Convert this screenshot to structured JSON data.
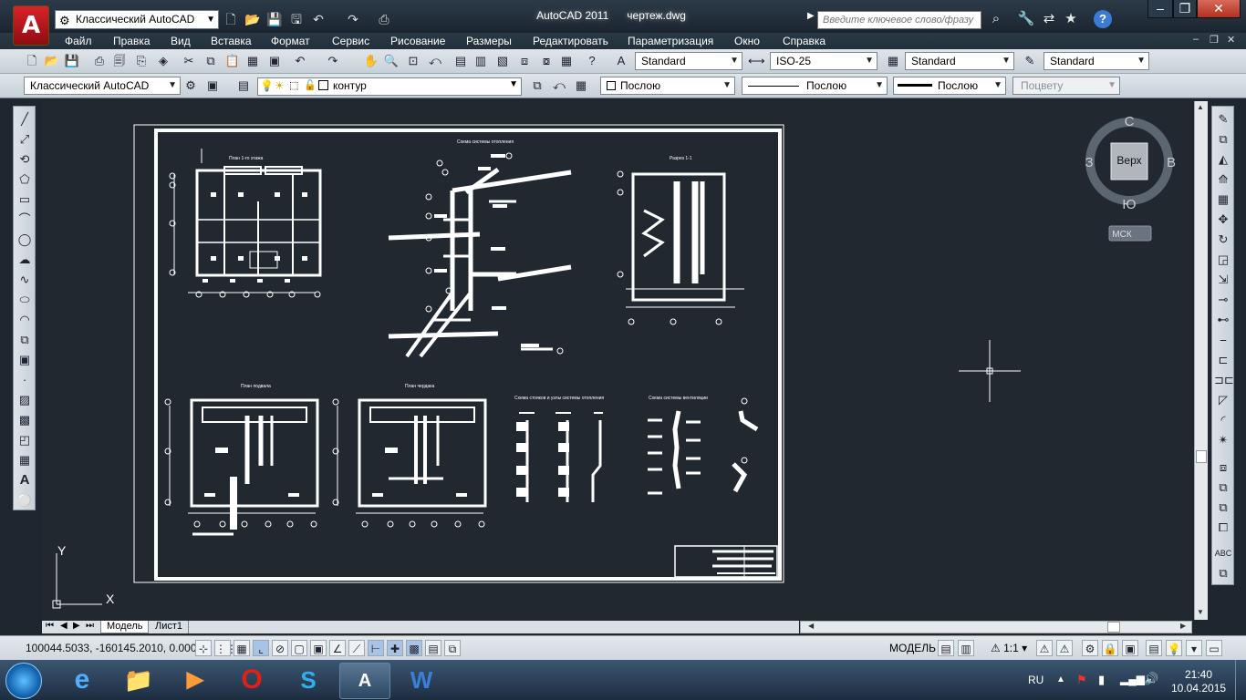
{
  "titlebar": {
    "workspace": "Классический AutoCAD",
    "app_name": "AutoCAD 2011",
    "doc_name": "чертеж.dwg",
    "search_placeholder": "Введите ключевое слово/фразу",
    "help": "?"
  },
  "menu": [
    "Файл",
    "Правка",
    "Вид",
    "Вставка",
    "Формат",
    "Сервис",
    "Рисование",
    "Размеры",
    "Редактировать",
    "Параметризация",
    "Окно",
    "Справка"
  ],
  "styles": {
    "text_style": "Standard",
    "dim_style": "ISO-25",
    "table_style": "Standard",
    "mleader_style": "Standard"
  },
  "layers": {
    "workspace": "Классический AutoCAD",
    "current_layer": "контур",
    "color": "Послою",
    "linetype": "Послою",
    "lineweight": "Послою",
    "plotstyle": "Поцвету"
  },
  "viewcube": {
    "north": "С",
    "south": "Ю",
    "east": "В",
    "west": "З",
    "face": "Верх",
    "ucs": "МСК"
  },
  "drawing": {
    "title_center": "Схема системы отопления",
    "title_right": "Разрез 1-1",
    "title_left": "План 1-го этажа",
    "title_bl1": "План подвала",
    "title_bl2": "План чердака",
    "title_bm": "Схема стояков и узлы системы отопления",
    "title_br": "Схема системы вентиляции",
    "ucs_x": "X",
    "ucs_y": "Y"
  },
  "tabs": {
    "model": "Модель",
    "sheet": "Лист1"
  },
  "status": {
    "coords": "100044.5033, -160145.2010, 0.0000",
    "model": "МОДЕЛЬ",
    "scale": "1:1"
  },
  "taskbar": {
    "lang": "RU",
    "time": "21:40",
    "date": "10.04.2015"
  }
}
